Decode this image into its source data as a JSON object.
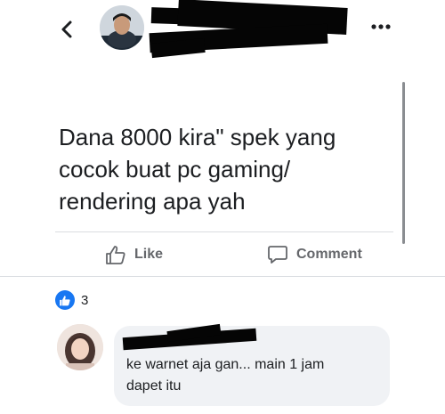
{
  "header": {
    "back_icon": "chevron-left-icon",
    "more_icon": "more-horizontal-icon"
  },
  "post": {
    "text": "Dana 8000 kira\" spek yang\ncocok buat pc gaming/\nrendering apa yah"
  },
  "actions": {
    "like_label": "Like",
    "comment_label": "Comment"
  },
  "reactions": {
    "count": "3",
    "icon": "thumbs-up-icon"
  },
  "comment": {
    "text": "ke warnet aja gan... main 1 jam\ndapet itu"
  },
  "colors": {
    "brand_blue": "#1877f2",
    "bubble_bg": "#f0f2f5",
    "muted_text": "#65676b"
  }
}
